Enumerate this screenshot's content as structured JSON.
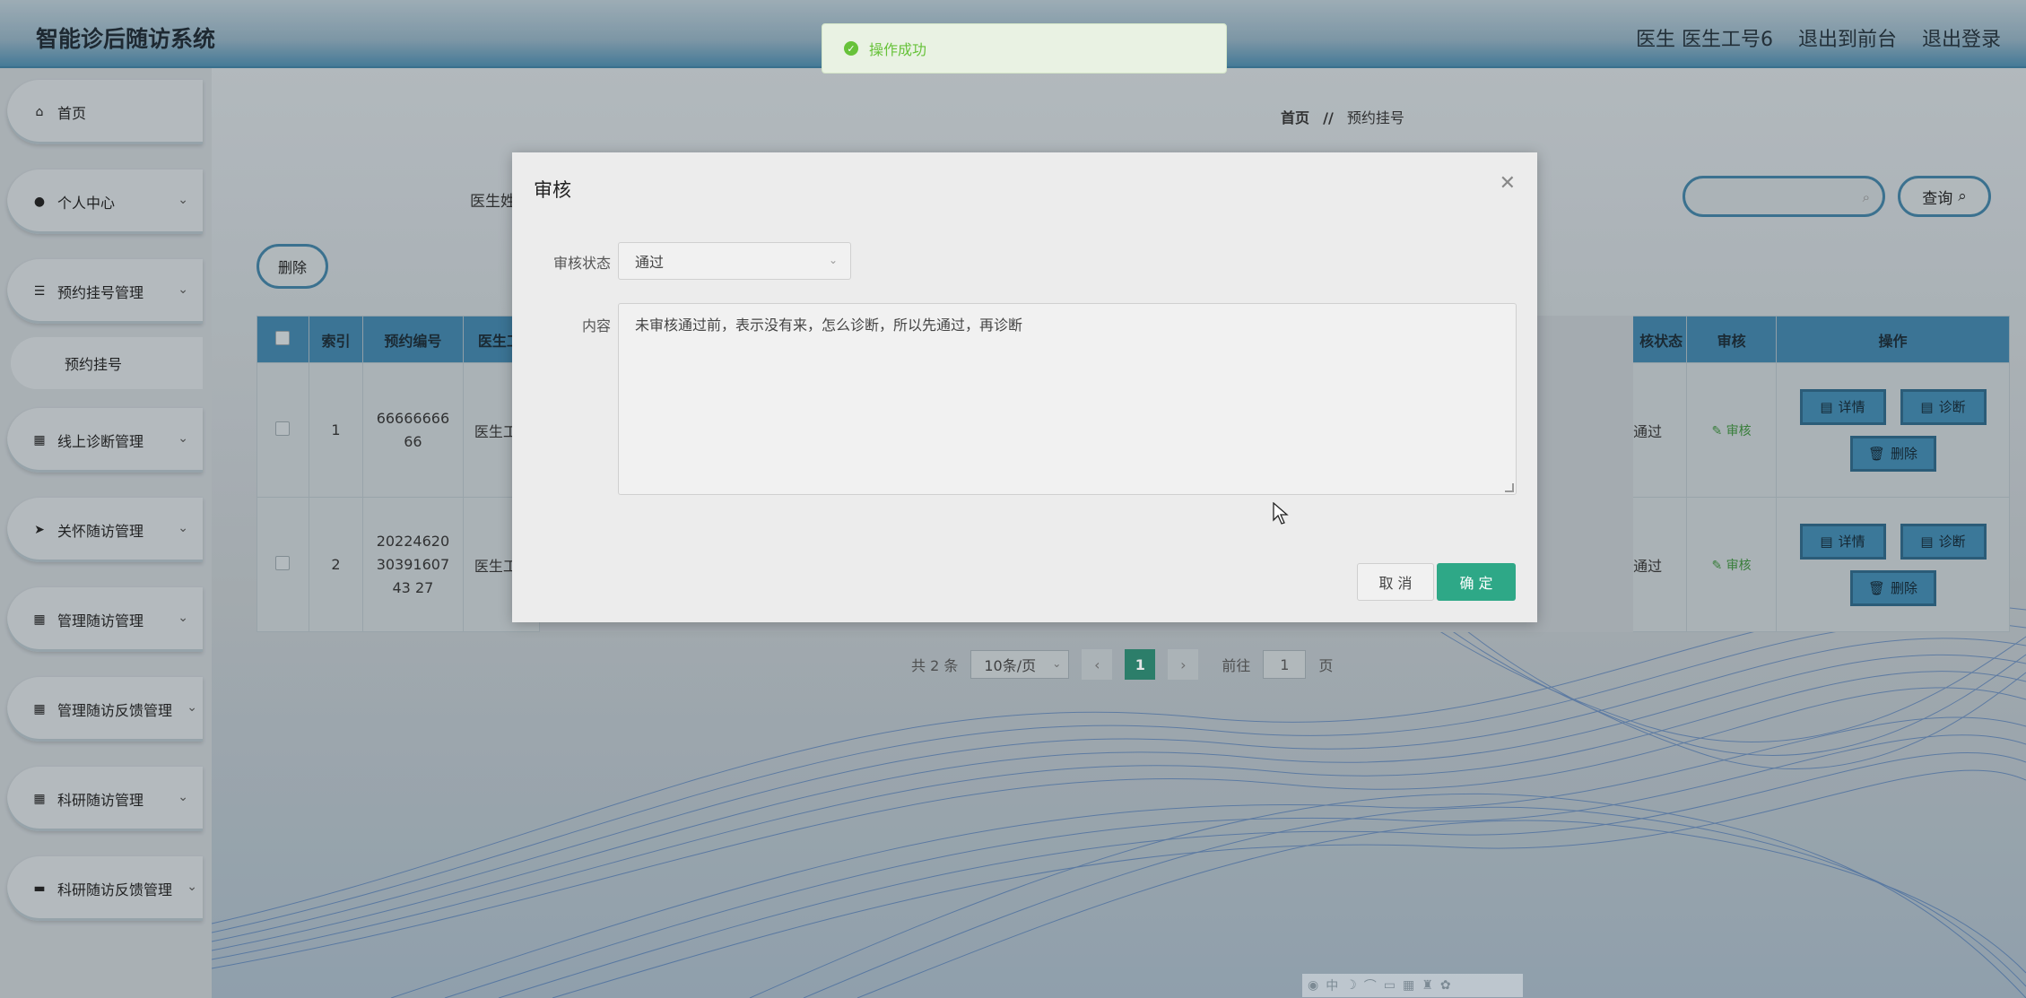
{
  "app": {
    "title": "智能诊后随访系统"
  },
  "topbar": {
    "user_label": "医生 医生工号6",
    "front_link": "退出到前台",
    "logout_link": "退出登录"
  },
  "sidebar": {
    "items": [
      {
        "label": "首页",
        "icon": "home-icon"
      },
      {
        "label": "个人中心",
        "icon": "user-icon"
      },
      {
        "label": "预约挂号管理",
        "icon": "sliders-icon"
      },
      {
        "label": "预约挂号",
        "icon": ""
      },
      {
        "label": "线上诊断管理",
        "icon": "grid-icon"
      },
      {
        "label": "关怀随访管理",
        "icon": "send-icon"
      },
      {
        "label": "管理随访管理",
        "icon": "grid-icon"
      },
      {
        "label": "管理随访反馈管理",
        "icon": "grid-icon"
      },
      {
        "label": "科研随访管理",
        "icon": "grid-icon"
      },
      {
        "label": "科研随访反馈管理",
        "icon": "briefcase-icon"
      }
    ]
  },
  "breadcrumb": {
    "home": "首页",
    "sep": "//",
    "current": "预约挂号"
  },
  "search": {
    "label": "医生姓",
    "query_label": "查询"
  },
  "toolbar": {
    "delete_label": "删除"
  },
  "table": {
    "headers": [
      "索引",
      "预约编号",
      "医生工",
      "核状态",
      "审核",
      "操作"
    ],
    "rows": [
      {
        "index": "1",
        "code": "6666666666",
        "doctor": "医生工",
        "status": "通过",
        "audit": "审核"
      },
      {
        "index": "2",
        "code": "202246203039160743 27",
        "doctor": "医生工",
        "status": "通过",
        "audit": "审核"
      }
    ],
    "actions": {
      "detail": "详情",
      "diagnose": "诊断",
      "delete": "删除"
    }
  },
  "pager": {
    "total": "共 2 条",
    "page_size": "10条/页",
    "current": "1",
    "goto_prefix": "前往",
    "goto_value": "1",
    "goto_suffix": "页"
  },
  "dialog": {
    "title": "审核",
    "status_label": "审核状态",
    "status_value": "通过",
    "content_label": "内容",
    "content_value": "未审核通过前，表示没有来，怎么诊断，所以先通过，再诊断",
    "cancel_label": "取 消",
    "ok_label": "确 定"
  },
  "toast": {
    "message": "操作成功"
  },
  "colors": {
    "accent": "#3f7fa3",
    "primary_button": "#2ea887",
    "success": "#67c23a"
  }
}
